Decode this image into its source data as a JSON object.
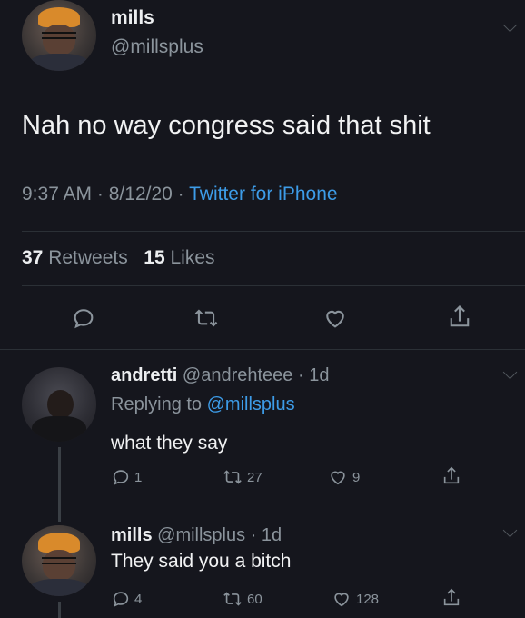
{
  "main_tweet": {
    "author_name": "mills",
    "author_handle": "@millsplus",
    "text": "Nah no way congress said that shit",
    "time": "9:37 AM",
    "date": "8/12/20",
    "source": "Twitter for iPhone",
    "retweets": "37",
    "retweets_label": "Retweets",
    "likes": "15",
    "likes_label": "Likes"
  },
  "replies": [
    {
      "author_name": "andretti",
      "author_handle": "@andrehteee",
      "age": "1d",
      "replying_prefix": "Replying to",
      "replying_to": "@millsplus",
      "text": "what they say",
      "reply_count": "1",
      "retweet_count": "27",
      "like_count": "9"
    },
    {
      "author_name": "mills",
      "author_handle": "@millsplus",
      "age": "1d",
      "text": "They said you a bitch",
      "reply_count": "4",
      "retweet_count": "60",
      "like_count": "128"
    }
  ],
  "separator": "·",
  "colors": {
    "background": "#15161d",
    "link_blue": "#3d9ce8",
    "muted_gray": "#8b949c"
  },
  "icons": [
    "reply-icon",
    "retweet-icon",
    "like-icon",
    "share-icon",
    "chevron-down-icon"
  ]
}
